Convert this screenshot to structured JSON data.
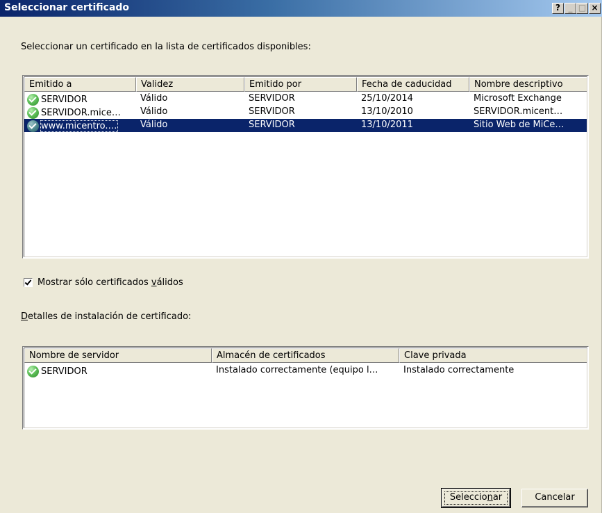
{
  "window": {
    "title": "Seleccionar certificado",
    "help_label": "?",
    "minimize_label": "_",
    "maximize_label": "□",
    "close_label": "×"
  },
  "instruction": "Seleccionar un certificado en la lista de certificados disponibles:",
  "cert_list": {
    "columns": [
      "Emitido a",
      "Validez",
      "Emitido por",
      "Fecha de caducidad",
      "Nombre descriptivo"
    ],
    "rows": [
      [
        "SERVIDOR",
        "Válido",
        "SERVIDOR",
        "25/10/2014",
        "Microsoft Exchange"
      ],
      [
        "SERVIDOR.mice…",
        "Válido",
        "SERVIDOR",
        "13/10/2010",
        "SERVIDOR.micent…"
      ],
      [
        "www.micentro.…",
        "Válido",
        "SERVIDOR",
        "13/10/2011",
        "Sitio Web de MiCe…"
      ]
    ],
    "selected_row": 2,
    "row_icon": "certificate-valid-icon"
  },
  "show_valid_only": {
    "label_prefix": "Mostrar sólo certificados ",
    "label_underlined": "v",
    "label_suffix": "álidos",
    "checked": true
  },
  "details": {
    "label_underlined": "D",
    "label_rest": "etalles de instalación de certificado:",
    "columns": [
      "Nombre de servidor",
      "Almacén de certificados",
      "Clave privada"
    ],
    "rows": [
      [
        "SERVIDOR",
        "Instalado correctamente (equipo l…",
        "Instalado correctamente"
      ]
    ]
  },
  "buttons": {
    "select_prefix": "Seleccio",
    "select_underlined": "n",
    "select_suffix": "ar",
    "cancel": "Cancelar"
  },
  "colors": {
    "selection": "#0a246a",
    "dialog_bg": "#ece9d8",
    "valid_icon": "#5fc05a"
  }
}
